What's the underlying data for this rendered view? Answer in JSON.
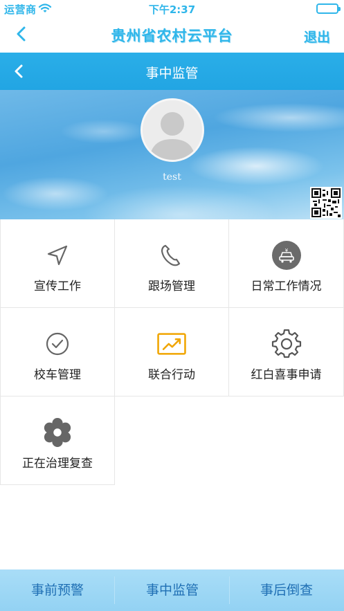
{
  "status_bar": {
    "carrier": "运营商",
    "time": "下午2:37"
  },
  "app_bar": {
    "title": "贵州省农村云平台",
    "logout_label": "退出"
  },
  "section_header": {
    "title": "事中监管"
  },
  "profile": {
    "username": "test"
  },
  "grid": {
    "items": [
      {
        "label": "宣传工作",
        "icon": "send-icon"
      },
      {
        "label": "跟场管理",
        "icon": "phone-icon"
      },
      {
        "label": "日常工作情况",
        "icon": "car-icon"
      },
      {
        "label": "校车管理",
        "icon": "check-circle-icon"
      },
      {
        "label": "联合行动",
        "icon": "trending-chart-icon"
      },
      {
        "label": "红白喜事申请",
        "icon": "gear-icon"
      },
      {
        "label": "正在治理复查",
        "icon": "flower-gear-icon"
      }
    ]
  },
  "tab_bar": {
    "tabs": [
      {
        "label": "事前预警"
      },
      {
        "label": "事中监管"
      },
      {
        "label": "事后倒查"
      }
    ]
  },
  "colors": {
    "accent": "#2fb6ea",
    "header_blue": "#22a5e3",
    "tabbar_bg": "#a9ddf7",
    "tab_text": "#1f6fb4",
    "chart_icon": "#f0a500"
  }
}
